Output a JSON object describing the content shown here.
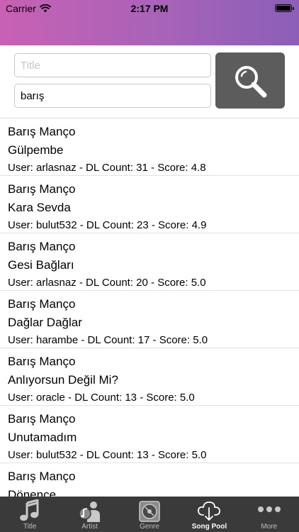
{
  "status": {
    "carrier": "Carrier",
    "time": "2:17 PM"
  },
  "search": {
    "title_placeholder": "Title",
    "title_value": "",
    "artist_value": "barış"
  },
  "results": [
    {
      "artist": "Barış Manço",
      "song": "Gülpembe",
      "meta": "User: arlasnaz - DL Count: 31 - Score: 4.8"
    },
    {
      "artist": "Barış Manço",
      "song": "Kara Sevda",
      "meta": "User: bulut532 - DL Count: 23 - Score: 4.9"
    },
    {
      "artist": "Barış Manço",
      "song": "Gesi Bağları",
      "meta": "User: arlasnaz - DL Count: 20 - Score: 5.0"
    },
    {
      "artist": "Barış Manço",
      "song": "Dağlar Dağlar",
      "meta": "User: harambe - DL Count: 17 - Score: 5.0"
    },
    {
      "artist": "Barış Manço",
      "song": "Anlıyorsun Değil Mi?",
      "meta": "User: oracle - DL Count: 13 - Score: 5.0"
    },
    {
      "artist": "Barış Manço",
      "song": "Unutamadım",
      "meta": "User: bulut532 - DL Count: 13 - Score: 5.0"
    },
    {
      "artist": "Barış Manço",
      "song": "Dönence",
      "meta": ""
    }
  ],
  "tabs": [
    {
      "label": "Title",
      "icon": "music-note-icon"
    },
    {
      "label": "Artist",
      "icon": "artist-icon"
    },
    {
      "label": "Genre",
      "icon": "genre-record-icon"
    },
    {
      "label": "Song Pool",
      "icon": "cloud-download-icon",
      "active": true
    },
    {
      "label": "More",
      "icon": "more-dots-icon"
    }
  ],
  "colors": {
    "header_gradient_start": "#c861b4",
    "header_gradient_end": "#8b5fb8",
    "search_button": "#5c5c5c",
    "tabbar": "#3a3a3a"
  }
}
